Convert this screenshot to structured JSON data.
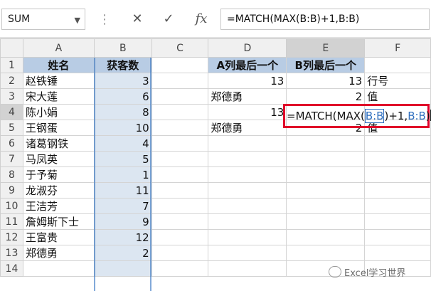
{
  "formula_bar": {
    "name_box": "SUM",
    "cancel_icon": "✕",
    "enter_icon": "✓",
    "fx_icon": "fx",
    "formula": "=MATCH(MAX(B:B)+1,B:B)"
  },
  "columns": [
    "A",
    "B",
    "C",
    "D",
    "E",
    "F"
  ],
  "rows": [
    {
      "n": "1",
      "a": "姓名",
      "b": "获客数",
      "d": "A列最后一个",
      "e": "B列最后一个",
      "f": ""
    },
    {
      "n": "2",
      "a": "赵铁锤",
      "b": "3",
      "d": "13",
      "e": "13",
      "f": "行号"
    },
    {
      "n": "3",
      "a": "宋大莲",
      "b": "6",
      "d": "郑德勇",
      "e": "2",
      "f": "值"
    },
    {
      "n": "4",
      "a": "陈小娟",
      "b": "8",
      "d": "13",
      "e": "",
      "f": ""
    },
    {
      "n": "5",
      "a": "王钢蛋",
      "b": "10",
      "d": "郑德勇",
      "e": "2",
      "f": "值"
    },
    {
      "n": "6",
      "a": "诸葛钢铁",
      "b": "4",
      "d": "",
      "e": "",
      "f": ""
    },
    {
      "n": "7",
      "a": "马凤英",
      "b": "5",
      "d": "",
      "e": "",
      "f": ""
    },
    {
      "n": "8",
      "a": "于予菊",
      "b": "1",
      "d": "",
      "e": "",
      "f": ""
    },
    {
      "n": "9",
      "a": "龙淑芬",
      "b": "11",
      "d": "",
      "e": "",
      "f": ""
    },
    {
      "n": "10",
      "a": "王洁芳",
      "b": "7",
      "d": "",
      "e": "",
      "f": ""
    },
    {
      "n": "11",
      "a": "詹姆斯下士",
      "b": "9",
      "d": "",
      "e": "",
      "f": ""
    },
    {
      "n": "12",
      "a": "王富贵",
      "b": "12",
      "d": "",
      "e": "",
      "f": ""
    },
    {
      "n": "13",
      "a": "郑德勇",
      "b": "2",
      "d": "",
      "e": "",
      "f": ""
    },
    {
      "n": "14",
      "a": "",
      "b": "",
      "d": "",
      "e": "",
      "f": ""
    }
  ],
  "editor": {
    "p1": "=MATCH(MAX(",
    "r1": "B:B",
    "p2": ")+1,",
    "r2": "B:B",
    "p3": ")"
  },
  "watermark": "Excel学习世界",
  "colors": {
    "header_fill": "#b8cce4",
    "column_b_fill": "#dce6f1",
    "highlight_border": "#e0002a",
    "reference_blue": "#2f6fbf"
  }
}
